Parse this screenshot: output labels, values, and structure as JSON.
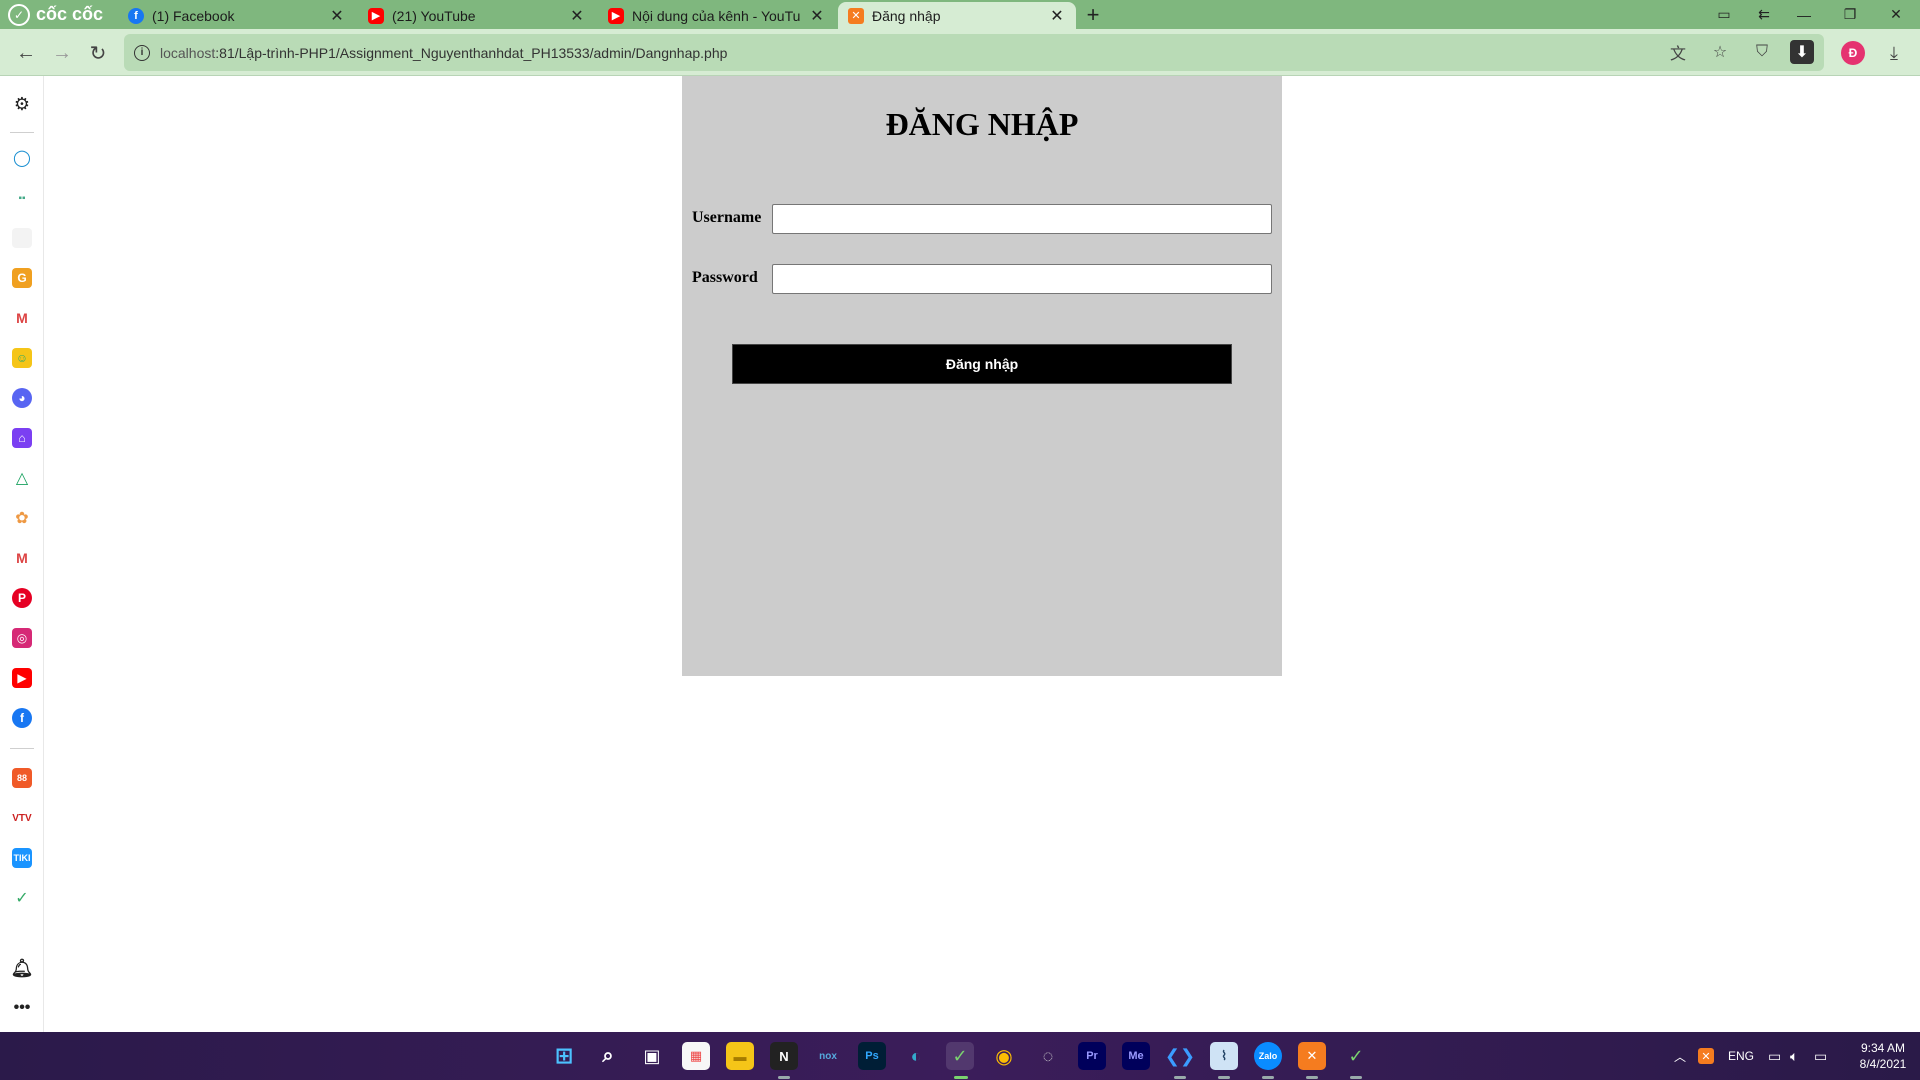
{
  "browser": {
    "brand": "cốc cốc",
    "tabs": [
      {
        "title": "(1) Facebook",
        "favicon": "facebook-icon"
      },
      {
        "title": "(21) YouTube",
        "favicon": "youtube-icon"
      },
      {
        "title": "Nội dung của kênh - YouTub",
        "favicon": "youtube-icon"
      },
      {
        "title": "Đăng nhập",
        "favicon": "xampp-icon",
        "active": true
      }
    ],
    "url_host": "localhost",
    "url_rest": ":81/Lập-trình-PHP1/Assignment_Nguyenthanhdat_PH13533/admin/Dangnhap.php",
    "profile_initial": "Đ"
  },
  "login": {
    "title": "ĐĂNG NHẬP",
    "username_label": "Username",
    "username_value": "",
    "password_label": "Password",
    "password_value": "",
    "submit_label": "Đăng nhập"
  },
  "taskbar": {
    "language": "ENG",
    "time": "9:34 AM",
    "date": "8/4/2021"
  },
  "colors": {
    "tabbar": "#7fb77e",
    "toolbar": "#d6ecd3",
    "panel": "#cccccc",
    "button": "#000000"
  }
}
